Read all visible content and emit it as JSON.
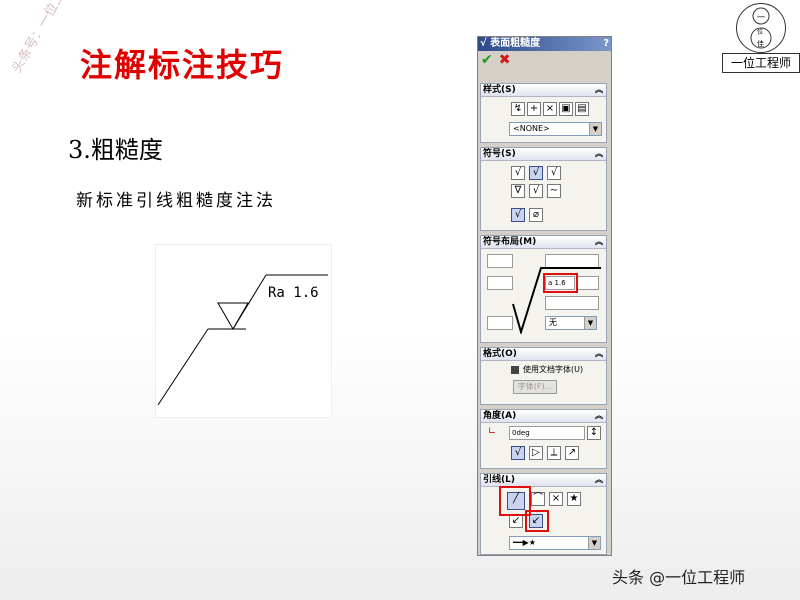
{
  "slide": {
    "title": "注解标注技巧",
    "subtitle": "3.粗糙度",
    "caption": "新标准引线粗糙度注法",
    "watermark": "头条号：一位工程师",
    "figure_label": "Ra 1.6",
    "logo_text": "一位工程师",
    "logo_glyphs": [
      "一",
      "位",
      "佳"
    ],
    "footer": "头条 @一位工程师"
  },
  "panel": {
    "title": "表面粗糙度",
    "help": "?",
    "ok_icon": "check-icon",
    "cancel_icon": "x-icon",
    "groups": {
      "style": {
        "label": "样式(S)",
        "combo_value": "<NONE>"
      },
      "symbol": {
        "label": "符号(S)"
      },
      "layout": {
        "label": "符号布局(M)",
        "value_field": "a 1.6",
        "direction_value": "无"
      },
      "format": {
        "label": "格式(O)",
        "use_doc_font": "使用文档字体(U)",
        "font_button": "字体(F)..."
      },
      "angle": {
        "label": "角度(A)",
        "value": "0deg"
      },
      "leader": {
        "label": "引线(L)"
      }
    }
  },
  "colors": {
    "title_red": "#e00000",
    "highlight_red": "#e01010",
    "panel_gray": "#d4d0c8",
    "titlebar_blue": "#2c4a8c"
  }
}
